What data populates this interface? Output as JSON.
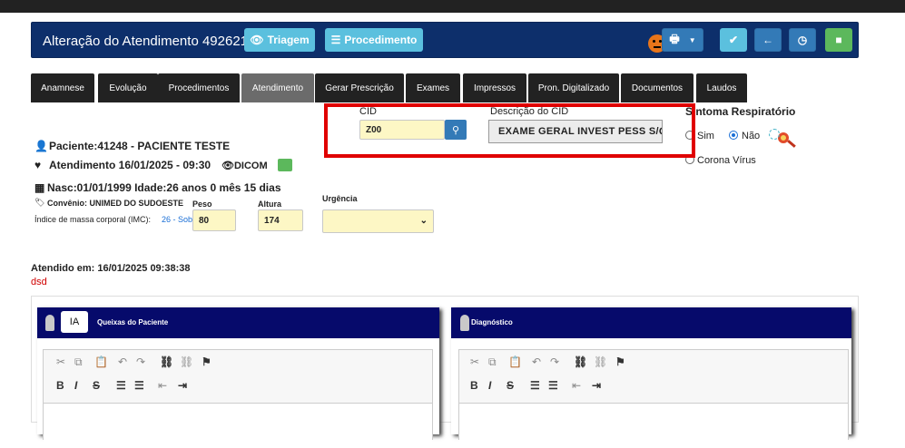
{
  "header": {
    "title": "Alteração do Atendimento 492621",
    "triagem_label": "Triagem",
    "procedimento_label": "Procedimento"
  },
  "tabs": [
    "Anamnese",
    "Evolução",
    "Procedimentos",
    "Atendimento",
    "Gerar Prescrição",
    "Exames",
    "Impressos",
    "Pron. Digitalizado",
    "Documentos",
    "Laudos"
  ],
  "patient": {
    "paciente": "Paciente:41248 - PACIENTE TESTE",
    "atendimento": "Atendimento 16/01/2025 - 09:30",
    "dicom": "DICOM",
    "nasc": "Nasc:01/01/1999 Idade:26 anos 0 mês 15 dias",
    "convenio": "Convênio: UNIMED DO SUDOESTE",
    "imc_label": "Índice de massa corporal (IMC):",
    "imc_value": "26 - Sob"
  },
  "vitals": {
    "peso_label": "Peso",
    "peso_value": "80",
    "altura_label": "Altura",
    "altura_value": "174",
    "urgencia_label": "Urgência",
    "urgencia_value": ""
  },
  "cid": {
    "label": "CID",
    "value": "Z00",
    "desc_label": "Descrição do CID",
    "desc_value": "EXAME GERAL INVEST PESS S/Q"
  },
  "respiratorio": {
    "label": "Sintoma Respiratório",
    "sim": "Sim",
    "nao": "Não",
    "corona": "Corona Vírus"
  },
  "atendido": {
    "label": "Atendido em: 16/01/2025 09:38:38",
    "note": "dsd"
  },
  "panels": {
    "queixas": "Queixas do Paciente",
    "ia": "IA",
    "diagnostico": "Diagnóstico"
  },
  "colors": {
    "header_bg": "#0d2f6b",
    "panel_header": "#060a6b",
    "highlight": "#e00000",
    "field_bg": "#fdf7c5"
  }
}
